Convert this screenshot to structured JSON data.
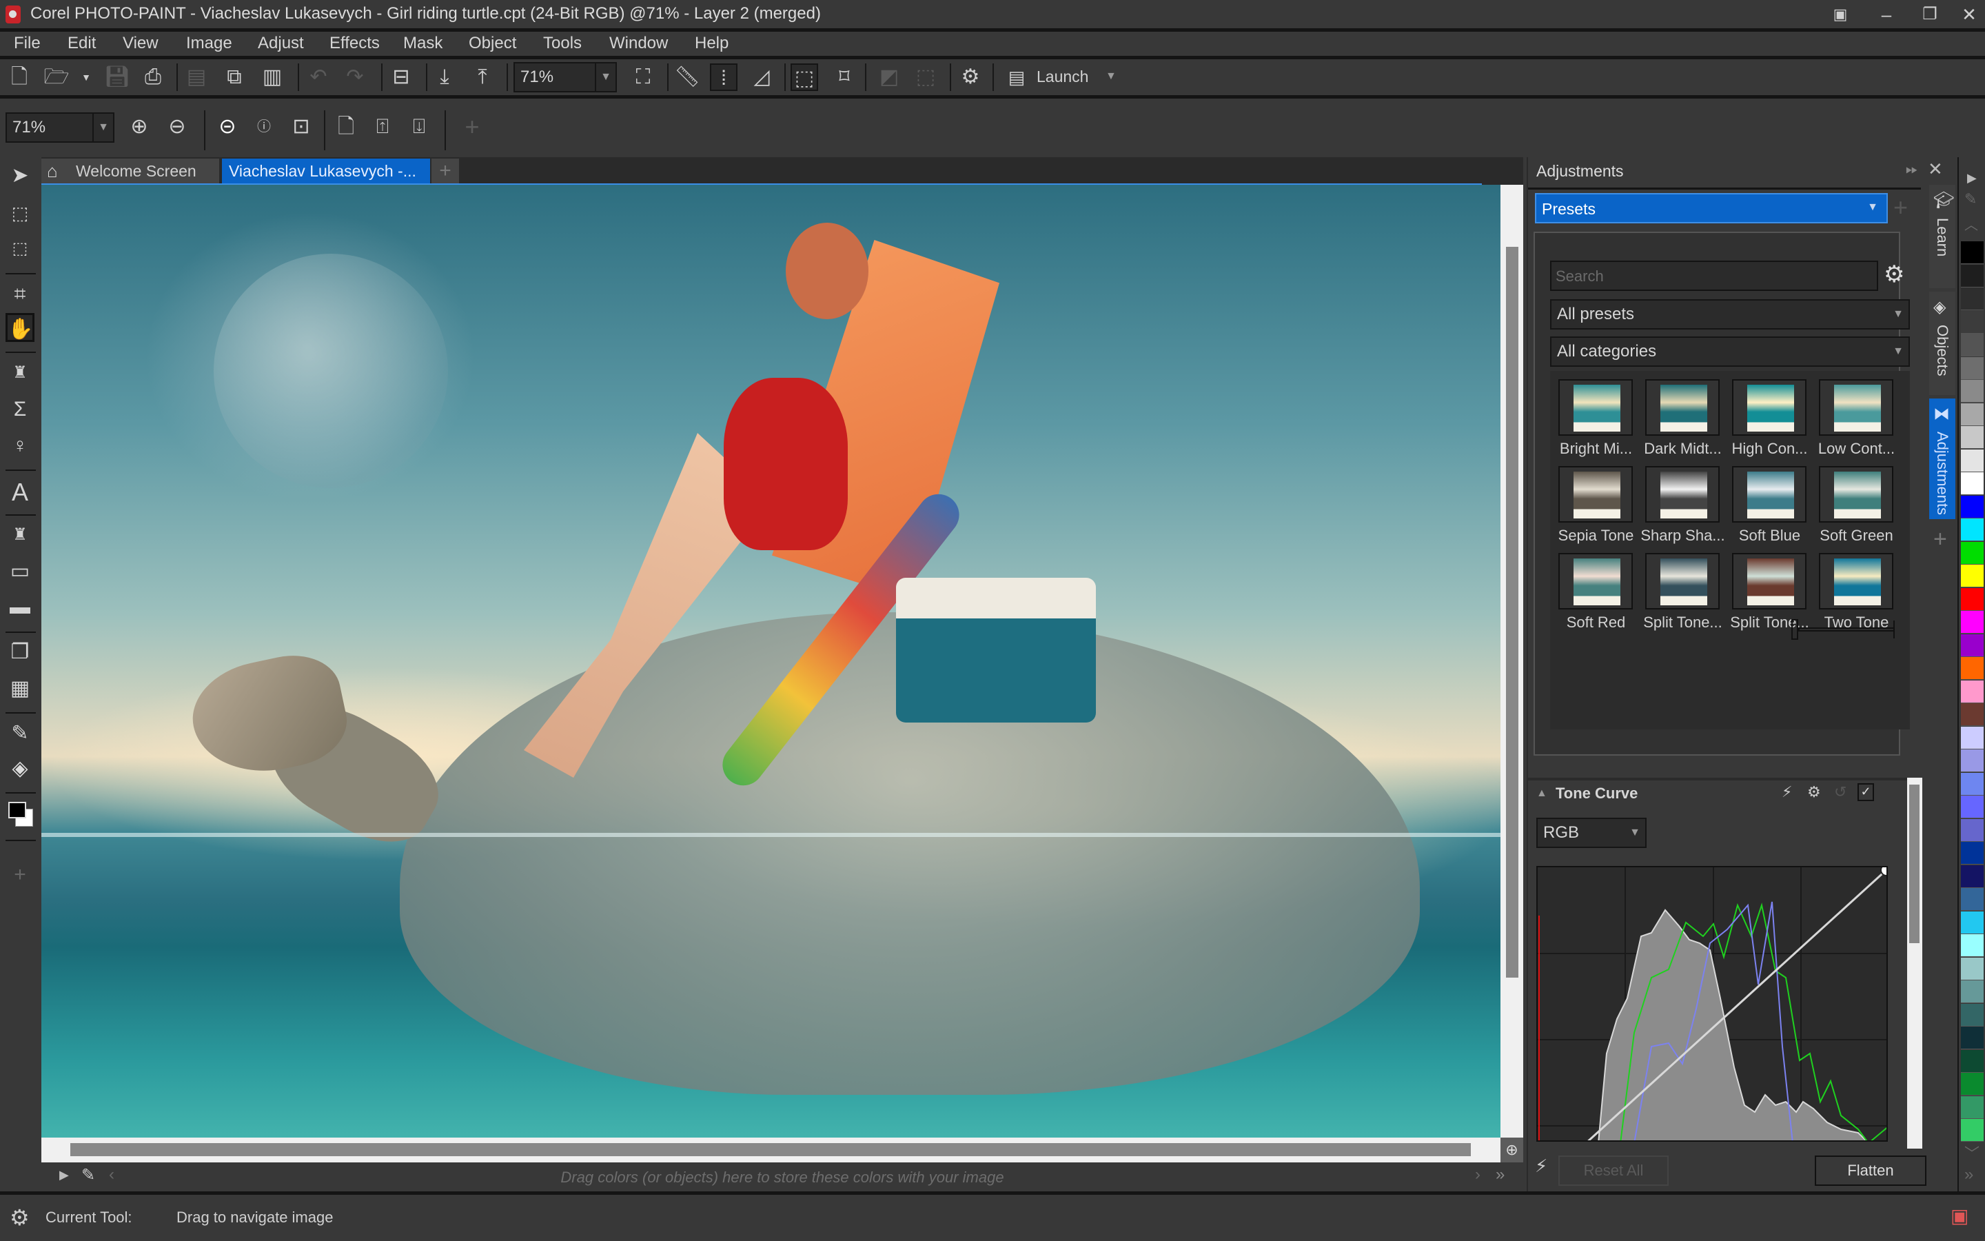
{
  "window": {
    "title": "Corel PHOTO-PAINT - Viacheslav Lukasevych - Girl riding turtle.cpt (24-Bit RGB) @71% - Layer 2 (merged)",
    "controls": [
      "minimize",
      "restore",
      "close"
    ]
  },
  "menu": [
    "File",
    "Edit",
    "View",
    "Image",
    "Adjust",
    "Effects",
    "Mask",
    "Object",
    "Tools",
    "Window",
    "Help"
  ],
  "toolbar": {
    "zoom_value": "71%",
    "launch_label": "Launch"
  },
  "zoombar": {
    "zoom_value": "71%"
  },
  "tabs": [
    {
      "label": "Welcome Screen",
      "icon": "home-icon",
      "active": false
    },
    {
      "label": "Viacheslav Lukasevych -...",
      "active": true
    }
  ],
  "toolbox": {
    "tools": [
      "pick",
      "rectangle-mask",
      "mask-transform",
      "crop",
      "pan",
      "touch-up",
      "smear",
      "liquid",
      "text",
      "paint",
      "rectangle",
      "eraser",
      "object-transparency",
      "checker",
      "eyedropper",
      "fill",
      "color-swatch"
    ]
  },
  "color_tray": {
    "hint": "Drag colors (or objects) here to store these colors with your image"
  },
  "status": {
    "label": "Current Tool:",
    "value": "Drag to navigate image"
  },
  "docker": {
    "title": "Adjustments",
    "mode": "Presets",
    "search_placeholder": "Search",
    "filter_presets": "All presets",
    "filter_categories": "All categories",
    "presets": [
      {
        "label": "Bright Mi...",
        "tint": "#2e8f96",
        "sky": "#f2e4bc"
      },
      {
        "label": "Dark Midt...",
        "tint": "#1f6f78",
        "sky": "#e6d9b4"
      },
      {
        "label": "High Con...",
        "tint": "#138e96",
        "sky": "#fff0c4"
      },
      {
        "label": "Low Cont...",
        "tint": "#4a9a9c",
        "sky": "#f0e2c2"
      },
      {
        "label": "Sepia Tone",
        "tint": "#5e564b",
        "sky": "#e2dccf"
      },
      {
        "label": "Sharp Sha...",
        "tint": "#444444",
        "sky": "#f2f2f2"
      },
      {
        "label": "Soft Blue",
        "tint": "#3d7c8a",
        "sky": "#e8ecef"
      },
      {
        "label": "Soft Green",
        "tint": "#3f7f7c",
        "sky": "#e6e8e0"
      },
      {
        "label": "Soft Red",
        "tint": "#46817f",
        "sky": "#f2ddd2"
      },
      {
        "label": "Split Tone...",
        "tint": "#34505c",
        "sky": "#e8e6dc"
      },
      {
        "label": "Split Tone...",
        "tint": "#6a3a2e",
        "sky": "#cfe0d8"
      },
      {
        "label": "Two Tone",
        "tint": "#10769a",
        "sky": "#f7ebc0"
      }
    ],
    "tone_curve": {
      "title": "Tone Curve",
      "channel": "RGB",
      "enabled": true
    },
    "reset_all_label": "Reset All",
    "flatten_label": "Flatten"
  },
  "side_tabs": [
    "Learn",
    "Objects",
    "Adjustments"
  ],
  "palette": [
    "#000000",
    "#1e1e1e",
    "#2e2e2e",
    "#3c3c3c",
    "#545454",
    "#6e6e6e",
    "#8a8a8a",
    "#a8a8a8",
    "#c8c8c8",
    "#e4e4e4",
    "#ffffff",
    "#0000ff",
    "#00e5ff",
    "#00dd00",
    "#ffff00",
    "#ff0000",
    "#ff00ff",
    "#9900cc",
    "#ff6600",
    "#ff99cc",
    "#6b3a30",
    "#ccccff",
    "#9999e6",
    "#6e86f0",
    "#6666ff",
    "#6666cc",
    "#003399",
    "#141464",
    "#336699",
    "#22c8f0",
    "#99ffff",
    "#99c8c8",
    "#669999",
    "#336666",
    "#0f2f38",
    "#0d4a32",
    "#0a8a2e",
    "#339966",
    "#33cc66"
  ]
}
